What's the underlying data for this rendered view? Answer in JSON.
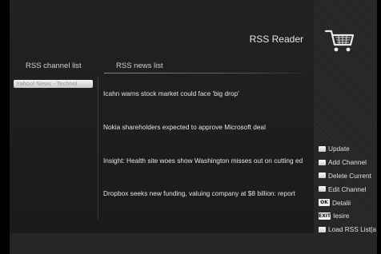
{
  "header": {
    "title": "RSS Reader",
    "icon": "shopping-cart-icon"
  },
  "columns": {
    "channels_label": "RSS channel list",
    "news_label": "RSS news list"
  },
  "channels": [
    {
      "label": "Yahoo! News - Technol"
    }
  ],
  "news": [
    {
      "title": "Icahn warns stock market could face 'big drop'"
    },
    {
      "title": "Nokia shareholders expected to approve Microsoft deal"
    },
    {
      "title": "Insight: Health site woes show Washington misses out on cutting ed"
    },
    {
      "title": "Dropbox seeks new funding, valuing company at $8 billion: report"
    }
  ],
  "actions": [
    {
      "label": "Update",
      "key": ""
    },
    {
      "label": "Add Channel",
      "key": ""
    },
    {
      "label": "Delete Current",
      "key": ""
    },
    {
      "label": "Edit Channel",
      "key": ""
    },
    {
      "label": "Detalii",
      "key": "OK"
    },
    {
      "label": "Iesire",
      "key": "EXIT"
    },
    {
      "label": "Load RSS List[a",
      "key": ""
    }
  ],
  "colors": {
    "background": "#1c1c1c",
    "text": "#e6e6e6",
    "selection": "#f4f4f4"
  }
}
